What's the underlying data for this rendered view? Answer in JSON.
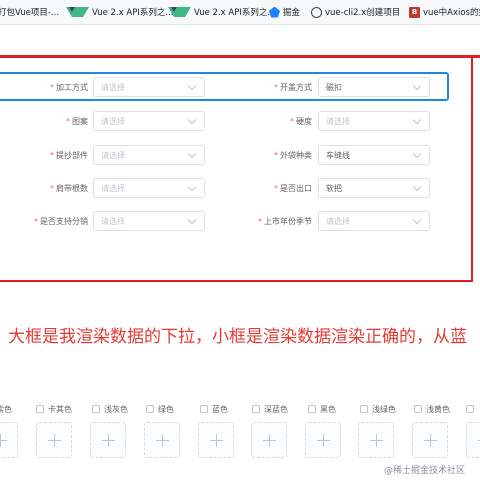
{
  "bookmarks": [
    {
      "label": "打包Vue项目-...",
      "icon": "page-icon"
    },
    {
      "label": "Vue 2.x API系列之...",
      "icon": "vue-icon"
    },
    {
      "label": "Vue 2.x API系列之...",
      "icon": "vue-icon"
    },
    {
      "label": "掘金",
      "icon": "juejin-icon"
    },
    {
      "label": "vue-cli2.x创建项目",
      "icon": "cli-icon"
    },
    {
      "label": "vue中Axios的封",
      "icon": "b3-icon"
    }
  ],
  "form": {
    "rows": [
      {
        "left": {
          "label": "加工方式",
          "required": true,
          "value": "",
          "placeholder": "请选择"
        },
        "right": {
          "label": "开盖方式",
          "required": true,
          "value": "磁扣",
          "placeholder": "请选择"
        }
      },
      {
        "left": {
          "label": "图案",
          "required": true,
          "value": "",
          "placeholder": "请选择"
        },
        "right": {
          "label": "硬度",
          "required": true,
          "value": "",
          "placeholder": "请选择"
        }
      },
      {
        "left": {
          "label": "提抄部件",
          "required": true,
          "value": "",
          "placeholder": "请选择"
        },
        "right": {
          "label": "外袋种类",
          "required": true,
          "value": "车缝线",
          "placeholder": "请选择"
        }
      },
      {
        "left": {
          "label": "肩带根数",
          "required": true,
          "value": "",
          "placeholder": "请选择"
        },
        "right": {
          "label": "是否出口",
          "required": true,
          "value": "软把",
          "placeholder": "请选择"
        }
      },
      {
        "left": {
          "label": "是否支持分销",
          "required": true,
          "value": "",
          "placeholder": "请选择"
        },
        "right": {
          "label": "上市年份季节",
          "required": true,
          "value": "",
          "placeholder": "请选择"
        }
      }
    ]
  },
  "caption": "大框是我渲染数据的下拉，小框是渲染数据渲染正确的，从蓝",
  "colors": [
    "紫色",
    "卡其色",
    "浅灰色",
    "绿色",
    "蓝色",
    "深蓝色",
    "黑色",
    "浅绿色",
    "浅黄色",
    "白色"
  ],
  "watermark": "@稀土掘金技术社区",
  "accent": {
    "red": "#e02020",
    "blue": "#1e88e5",
    "required": "#f56c6c"
  }
}
